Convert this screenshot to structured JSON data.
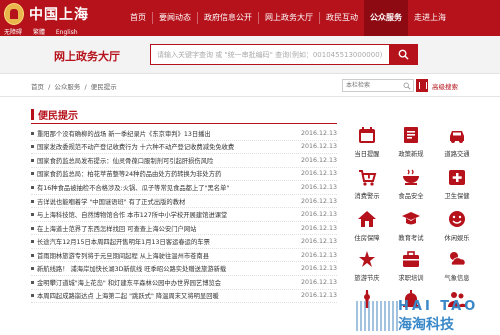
{
  "brand": {
    "logo_title": "中国上海",
    "sub_links": [
      "无障碍",
      "繁體",
      "English"
    ],
    "primary_color": "#b5121b"
  },
  "nav": {
    "items": [
      "首页",
      "要闻动态",
      "政府信息公开",
      "网上政务大厅",
      "政民互动",
      "公众服务",
      "走进上海"
    ],
    "active": "公众服务"
  },
  "search": {
    "title": "网上政务大厅",
    "placeholder": "请输入关键字查询 或 \"统一串批编码\" 查询(例如：001045513000000)",
    "button_icon": "search-icon"
  },
  "breadcrumb": [
    "首页",
    "/",
    "公众服务",
    "/",
    "便民提示"
  ],
  "column_search": {
    "placeholder": "本栏检索",
    "advanced_label": "高级搜索"
  },
  "section": {
    "title": "便民提示"
  },
  "news": [
    {
      "title": "重阳那个没有确柳的战场 新一季纪录片《东京审判》13日播出",
      "date": "2016.12.13"
    },
    {
      "title": "国家发改委规范不动产登记收费行为 十六种不动产登记收费减免免收费",
      "date": "2016.12.13"
    },
    {
      "title": "国家食药监总局发布提示：仙灵骨葆口服制剂可引起肝损伤风险",
      "date": "2016.12.13"
    },
    {
      "title": "国家食药监总局：柏花苹苗整等24种药品由处方药转换为非处方药",
      "date": "2016.12.13"
    },
    {
      "title": "有16种食品被抽检不合格涉及:火锅、瓜子等常见食品都上了\"黑名单\"",
      "date": "2016.12.13"
    },
    {
      "title": "吉详说也能嗰着学 \"中国谜语班\" 有了正式出版的教材",
      "date": "2016.12.13"
    },
    {
      "title": "与上海科技馆、自然博物馆合作 本市127所中小学校开展建馆进课堂",
      "date": "2016.12.13"
    },
    {
      "title": "在上海道士范界了东西怎样找回 可查查上海公安门户网站",
      "date": "2016.12.13"
    },
    {
      "title": "长途汽车12月15日本周四起开售明年1月13日客运春运的车票",
      "date": "2016.12.13"
    },
    {
      "title": "首雨期林旅游专列将于元旦期间起程 从上海驶往温州市苍南县",
      "date": "2016.12.13"
    },
    {
      "title": "新航线路！ 浦海岸加快长湖3D新航线 旺季昭公路实处赠送旅游新载",
      "date": "2016.12.13"
    },
    {
      "title": "金明攀汀道城\"海上花岛\" 和灯建东平森林公园中办世界园艺博览会",
      "date": "2016.12.13"
    },
    {
      "title": "本周四起成路崩达点 上海第二起 \"跳跃式\" 降温周末又将明显回暖",
      "date": "2016.12.13"
    }
  ],
  "services": [
    {
      "label": "当日提醒",
      "icon": "calendar-icon",
      "col": 0,
      "row": 0
    },
    {
      "label": "政策新规",
      "icon": "policy-book-icon",
      "col": 1,
      "row": 0
    },
    {
      "label": "道路交通",
      "icon": "car-icon",
      "col": 2,
      "row": 0
    },
    {
      "label": "消费警示",
      "icon": "cart-warning-icon",
      "col": 0,
      "row": 1
    },
    {
      "label": "食品安全",
      "icon": "food-bowl-icon",
      "col": 1,
      "row": 1
    },
    {
      "label": "卫生保健",
      "icon": "medical-cross-icon",
      "col": 2,
      "row": 1
    },
    {
      "label": "住房保障",
      "icon": "house-icon",
      "col": 0,
      "row": 2
    },
    {
      "label": "教育考试",
      "icon": "education-icon",
      "col": 1,
      "row": 2
    },
    {
      "label": "休闲娱乐",
      "icon": "smile-icon",
      "col": 2,
      "row": 2
    },
    {
      "label": "旅游节庆",
      "icon": "travel-icon",
      "col": 0,
      "row": 3
    },
    {
      "label": "求职培训",
      "icon": "job-icon",
      "col": 1,
      "row": 3
    },
    {
      "label": "气象信息",
      "icon": "weather-icon",
      "col": 2,
      "row": 3
    },
    {
      "label": "",
      "icon": "tower-icon",
      "col": 0,
      "row": 4
    },
    {
      "label": "",
      "icon": "alarm-icon",
      "col": 1,
      "row": 4
    },
    {
      "label": "",
      "icon": "people-icon",
      "col": 2,
      "row": 4
    }
  ],
  "watermark": {
    "top": "HAI TAO",
    "bottom": "海淘科技"
  }
}
